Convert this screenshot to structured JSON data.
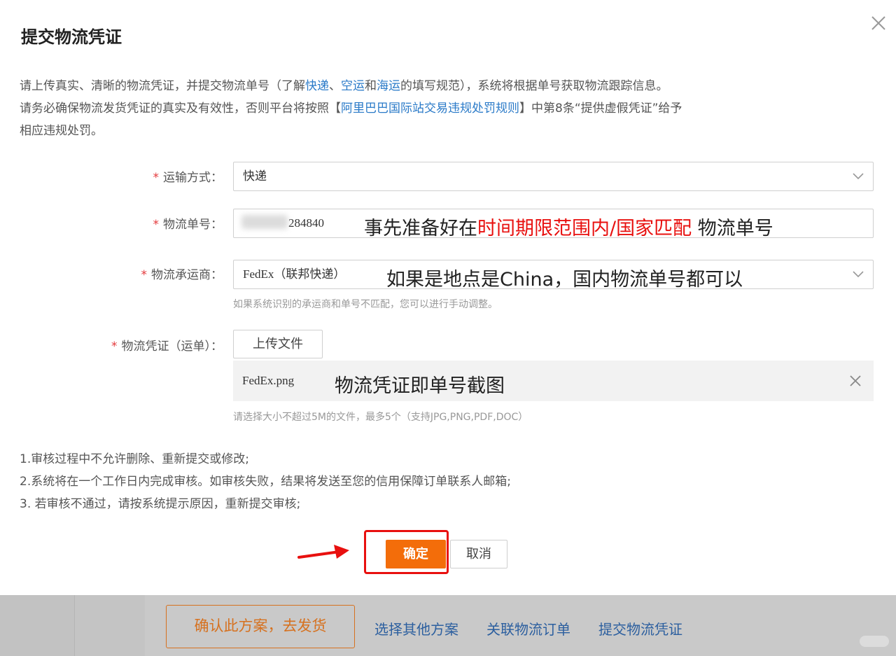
{
  "dialog": {
    "title": "提交物流凭证",
    "desc": {
      "p1_a": "请上传真实、清晰的物流凭证，并提交物流单号（了解",
      "link_express": "快递",
      "sep1": "、",
      "link_air": "空运",
      "and": "和",
      "link_sea": "海运",
      "p1_b": "的填写规范），系统将根据单号获取物流跟踪信息。",
      "p2_a": "请务必确保物流发货凭证的真实及有效性，否则平台将按照【",
      "link_rules": "阿里巴巴国际站交易违规处罚规则",
      "p2_b": "】中第8条“提供虚假凭证”给予",
      "p3": "相应违规处罚。"
    },
    "form": {
      "shipping_method": {
        "label": "运输方式：",
        "value": "快递"
      },
      "tracking_no": {
        "label": "物流单号：",
        "value": "284840"
      },
      "carrier": {
        "label": "物流承运商：",
        "value": "FedEx（联邦快递）",
        "hint": "如果系统识别的承运商和单号不匹配，您可以进行手动调整。"
      },
      "voucher": {
        "label": "物流凭证（运单）：",
        "upload_label": "上传文件",
        "file_name": "FedEx.png",
        "hint": "请选择大小不超过5M的文件，最多5个（支持JPG,PNG,PDF,DOC）"
      }
    },
    "annotations": {
      "tracking_a": "事先准备好在",
      "tracking_red": "时间期限范围内/国家匹配",
      "tracking_b": " 物流单号",
      "carrier": "如果是地点是China，国内物流单号都可以",
      "voucher": "物流凭证即单号截图"
    },
    "notes": [
      "1.审核过程中不允许删除、重新提交或修改;",
      "2.系统将在一个工作日内完成审核。如审核失败，结果将发送至您的信用保障订单联系人邮箱;",
      "3. 若审核不通过，请按系统提示原因，重新提交审核;"
    ],
    "buttons": {
      "confirm": "确定",
      "cancel": "取消"
    },
    "required_mark": "*"
  },
  "footer": {
    "cta": "确认此方案，去发货",
    "links": [
      "选择其他方案",
      "关联物流订单",
      "提交物流凭证"
    ]
  },
  "colors": {
    "accent": "#f36d0a",
    "link": "#2a7ac8",
    "highlight": "#e8100f"
  }
}
